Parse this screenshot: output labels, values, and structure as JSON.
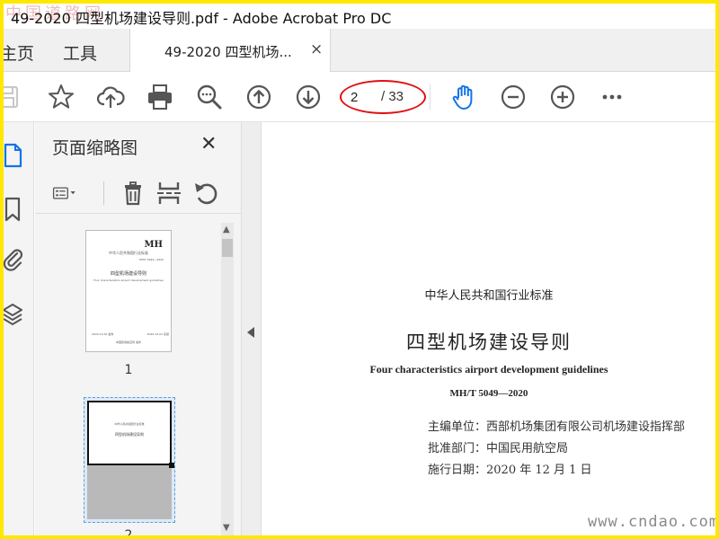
{
  "window": {
    "title": "49-2020 四型机场建设导则.pdf - Adobe Acrobat Pro DC",
    "corner_stamp": "中国道路网"
  },
  "tabs": {
    "home": "主页",
    "tools": "工具",
    "document": "49-2020 四型机场...",
    "close_glyph": "×"
  },
  "toolbar": {
    "icons": [
      "save-icon",
      "star-icon",
      "cloud-upload-icon",
      "print-icon",
      "zoom-search-icon",
      "arrow-up-circle-icon",
      "arrow-down-circle-icon",
      "hand-icon",
      "zoom-out-icon",
      "zoom-in-icon",
      "more-icon"
    ],
    "current_page": "2",
    "total_pages": "/ 33",
    "accent": "#1473e6",
    "annotation_color": "#e01010"
  },
  "left_rail": {
    "icons": [
      "page-thumbnails-icon",
      "bookmark-icon",
      "attachment-icon",
      "layers-icon"
    ]
  },
  "thumbnail_panel": {
    "title": "页面缩略图",
    "close_glyph": "✕",
    "tool_icons": [
      "options-menu-icon",
      "delete-icon",
      "insert-page-icon",
      "rotate-icon"
    ],
    "thumbnails": [
      {
        "number": "1",
        "logo": "MH",
        "header": "中华人民共和国行业标准",
        "title": "四型机场建设导则",
        "subtitle": "Four characteristics airport development guidelines",
        "code": "MH/T 5049—2020",
        "issued": "2020-10-30 发布",
        "effective": "2020-12-01 实施",
        "publisher": "中国民用航空局 发布"
      },
      {
        "number": "2",
        "header": "中华人民共和国行业标准",
        "title": "四型机场建设导则"
      }
    ]
  },
  "document_page": {
    "header": "中华人民共和国行业标准",
    "title": "四型机场建设导则",
    "subtitle": "Four characteristics airport development guidelines",
    "code": "MH/T 5049—2020",
    "chief_editor": "主编单位：西部机场集团有限公司机场建设指挥部",
    "approver": "批准部门：中国民用航空局",
    "effective_date": "施行日期：2020 年 12 月 1 日"
  },
  "watermark": "www.cndao.com"
}
